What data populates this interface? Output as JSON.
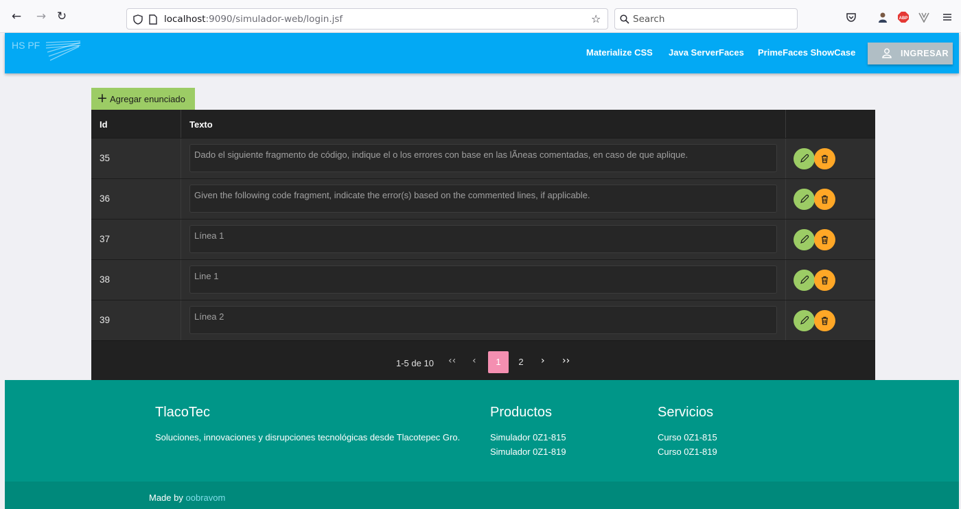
{
  "browser": {
    "url_host": "localhost",
    "url_rest": ":9090/simulador-web/login.jsf",
    "search_placeholder": "Search"
  },
  "navbar": {
    "brand": "HS PF",
    "links": [
      "Materialize CSS",
      "Java ServerFaces",
      "PrimeFaces ShowCase"
    ],
    "login_label": "INGRESAR"
  },
  "add_button_label": "Agregar enunciado",
  "table": {
    "headers": {
      "id": "Id",
      "text": "Texto"
    },
    "rows": [
      {
        "id": "35",
        "text": "Dado el siguiente fragmento de código, indique el o los errores con base en las lÃneas comentadas, en caso de que aplique."
      },
      {
        "id": "36",
        "text": "Given the following code fragment, indicate the error(s) based on the commented lines, if applicable."
      },
      {
        "id": "37",
        "text": "Línea 1"
      },
      {
        "id": "38",
        "text": "Line 1"
      },
      {
        "id": "39",
        "text": "Línea 2"
      }
    ]
  },
  "paginator": {
    "info": "1-5 de 10",
    "first": "‹‹",
    "prev": "‹",
    "pages": [
      "1",
      "2"
    ],
    "active_page": "1",
    "next": "›",
    "last": "››"
  },
  "footer": {
    "brand_title": "TlacoTec",
    "brand_text": "Soluciones, innovaciones y disrupciones tecnológicas desde Tlacotepec Gro.",
    "products_title": "Productos",
    "products": [
      "Simulador 0Z1-815",
      "Simulador 0Z1-819"
    ],
    "services_title": "Servicios",
    "services": [
      "Curso 0Z1-815",
      "Curso 0Z1-819"
    ],
    "made_by": "Made by",
    "author": "oobravom"
  },
  "colors": {
    "navbar": "#03a9f4",
    "add_button": "#9ccc65",
    "edit_button": "#9ccc65",
    "delete_button": "#ffa726",
    "active_page": "#f48fb1",
    "footer": "#009688"
  },
  "icons": {
    "back": "arrow-left-icon",
    "forward": "arrow-right-icon",
    "reload": "reload-icon",
    "shield": "shield-icon",
    "page": "page-icon",
    "bookmark": "star-icon",
    "search": "search-icon",
    "pocket": "pocket-icon",
    "profile": "profile-icon",
    "adblock": "adblock-icon",
    "extension": "extension-icon",
    "menu": "hamburger-menu-icon",
    "user": "user-icon",
    "edit": "pencil-icon",
    "delete": "trash-icon"
  }
}
